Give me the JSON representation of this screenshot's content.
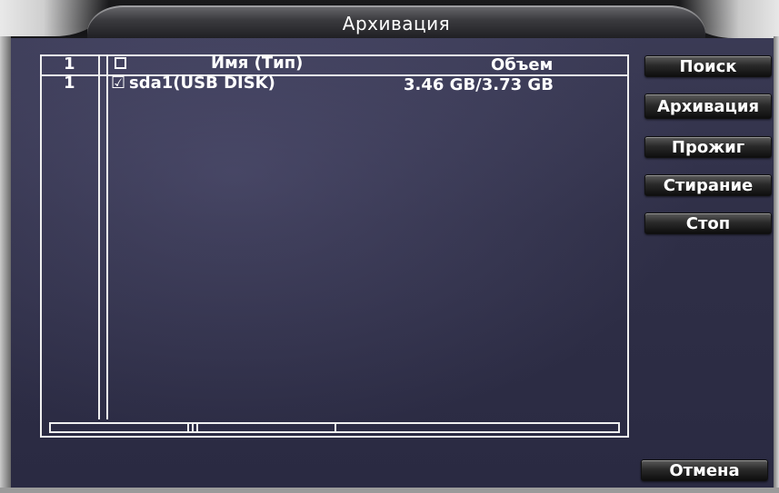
{
  "window": {
    "title": "Архивация"
  },
  "table": {
    "header": {
      "index": "1",
      "name_type": "Имя (Тип)",
      "volume": "Объем"
    },
    "rows": [
      {
        "index": "1",
        "checked": true,
        "check_glyph": "☑",
        "name": "sda1(USB DISK)",
        "volume": "3.46 GB/3.73 GB"
      }
    ]
  },
  "buttons": {
    "search": "Поиск",
    "backup": "Архивация",
    "burn": "Прожиг",
    "erase": "Стирание",
    "stop": "Стоп",
    "cancel": "Отмена"
  },
  "colors": {
    "background": "#2f2f47",
    "text": "#ffffff",
    "button": "#1a1a1a"
  }
}
